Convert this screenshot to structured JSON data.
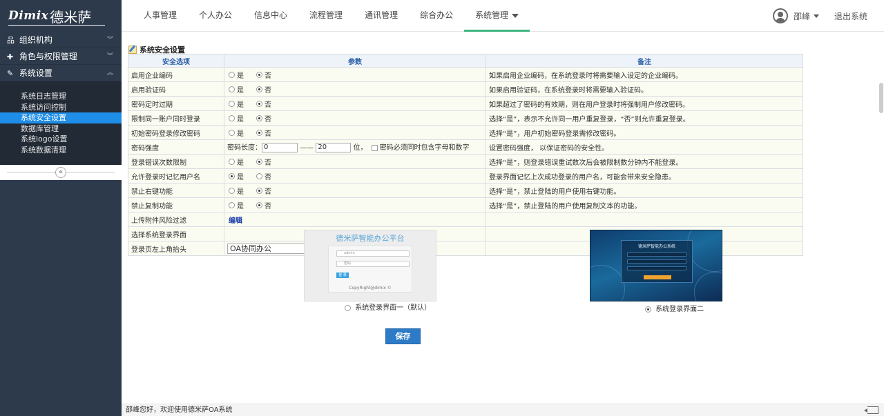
{
  "header": {
    "brand_en": "Dimix",
    "brand_cn": "德米萨",
    "nav": [
      {
        "label": "人事管理"
      },
      {
        "label": "个人办公"
      },
      {
        "label": "信息中心"
      },
      {
        "label": "流程管理"
      },
      {
        "label": "通讯管理"
      },
      {
        "label": "综合办公"
      },
      {
        "label": "系统管理",
        "active": true
      }
    ],
    "user_name": "邵峰",
    "logout_label": "退出系统"
  },
  "sidebar": {
    "menus": [
      {
        "label": "组织机构",
        "icon": "org-chart-icon"
      },
      {
        "label": "角色与权限管理",
        "icon": "pin-icon"
      },
      {
        "label": "系统设置",
        "icon": "wrench-icon"
      }
    ],
    "subitems": [
      {
        "label": "系统日志管理"
      },
      {
        "label": "系统访问控制"
      },
      {
        "label": "系统安全设置",
        "active": true
      },
      {
        "label": "数据库管理"
      },
      {
        "label": "系统logo设置"
      },
      {
        "label": "系统数据清理"
      }
    ],
    "collapse_glyph": "«"
  },
  "page": {
    "title": "系统安全设置",
    "columns": {
      "option": "安全选项",
      "param": "参数",
      "note": "备注"
    },
    "yes": "是",
    "no": "否",
    "rows": [
      {
        "option": "启用企业编码",
        "yes": false,
        "note": "如果启用企业编码，在系统登录时将需要输入设定的企业编码。"
      },
      {
        "option": "启用验证码",
        "yes": false,
        "note": "如果启用验证码，在系统登录时将需要输入验证码。"
      },
      {
        "option": "密码定时过期",
        "yes": false,
        "note": "如果超过了密码的有效期，则在用户登录时将强制用户修改密码。"
      },
      {
        "option": "限制同一账户同时登录",
        "yes": false,
        "note": "选择“是”，表示不允许同一用户重复登录，“否”则允许重复登录。"
      },
      {
        "option": "初始密码登录修改密码",
        "yes": false,
        "note": "选择“是”，用户初始密码登录需修改密码。"
      }
    ],
    "password_strength": {
      "option": "密码强度",
      "length_label": "密码长度：",
      "min": "0",
      "dash": "——",
      "max": "20",
      "unit": "位，",
      "mixed_label": "密码必须同时包含字母和数字",
      "note": "设置密码强度， 以保证密码的安全性。"
    },
    "rows2": [
      {
        "option": "登录错误次数限制",
        "yes": false,
        "note": "选择“是”，则登录错误重试数次后会被限制数分钟内不能登录。"
      },
      {
        "option": "允许登录时记忆用户名",
        "yes": true,
        "note": "登录界面记忆上次成功登录的用户名，可能会带来安全隐患。"
      },
      {
        "option": "禁止右键功能",
        "yes": false,
        "note": "选择“是”，禁止登陆的用户使用右键功能。"
      },
      {
        "option": "禁止复制功能",
        "yes": false,
        "note": "选择“是”，禁止登陆的用户使用复制文本的功能。"
      }
    ],
    "upload_filter": {
      "option": "上传附件风险过滤",
      "link": "编辑"
    },
    "login_screen": {
      "option": "选择系统登录界面",
      "thumb1_title": "德米萨智能办公平台",
      "thumb1_user": "admin",
      "thumb1_pass": "密码",
      "thumb1_btn": "登 录",
      "thumb1_copy": "CopyRight@dimix ©",
      "option1": "系统登录界面一（默认）",
      "thumb2_title": "德米萨智能办公系统",
      "option2": "系统登录界面二",
      "selected": 2
    },
    "login_header": {
      "option": "登录页左上角抬头",
      "value": "OA协同办公"
    },
    "save_label": "保存"
  },
  "footer": {
    "welcome": "邵峰您好，欢迎使用德米萨OA系统"
  }
}
